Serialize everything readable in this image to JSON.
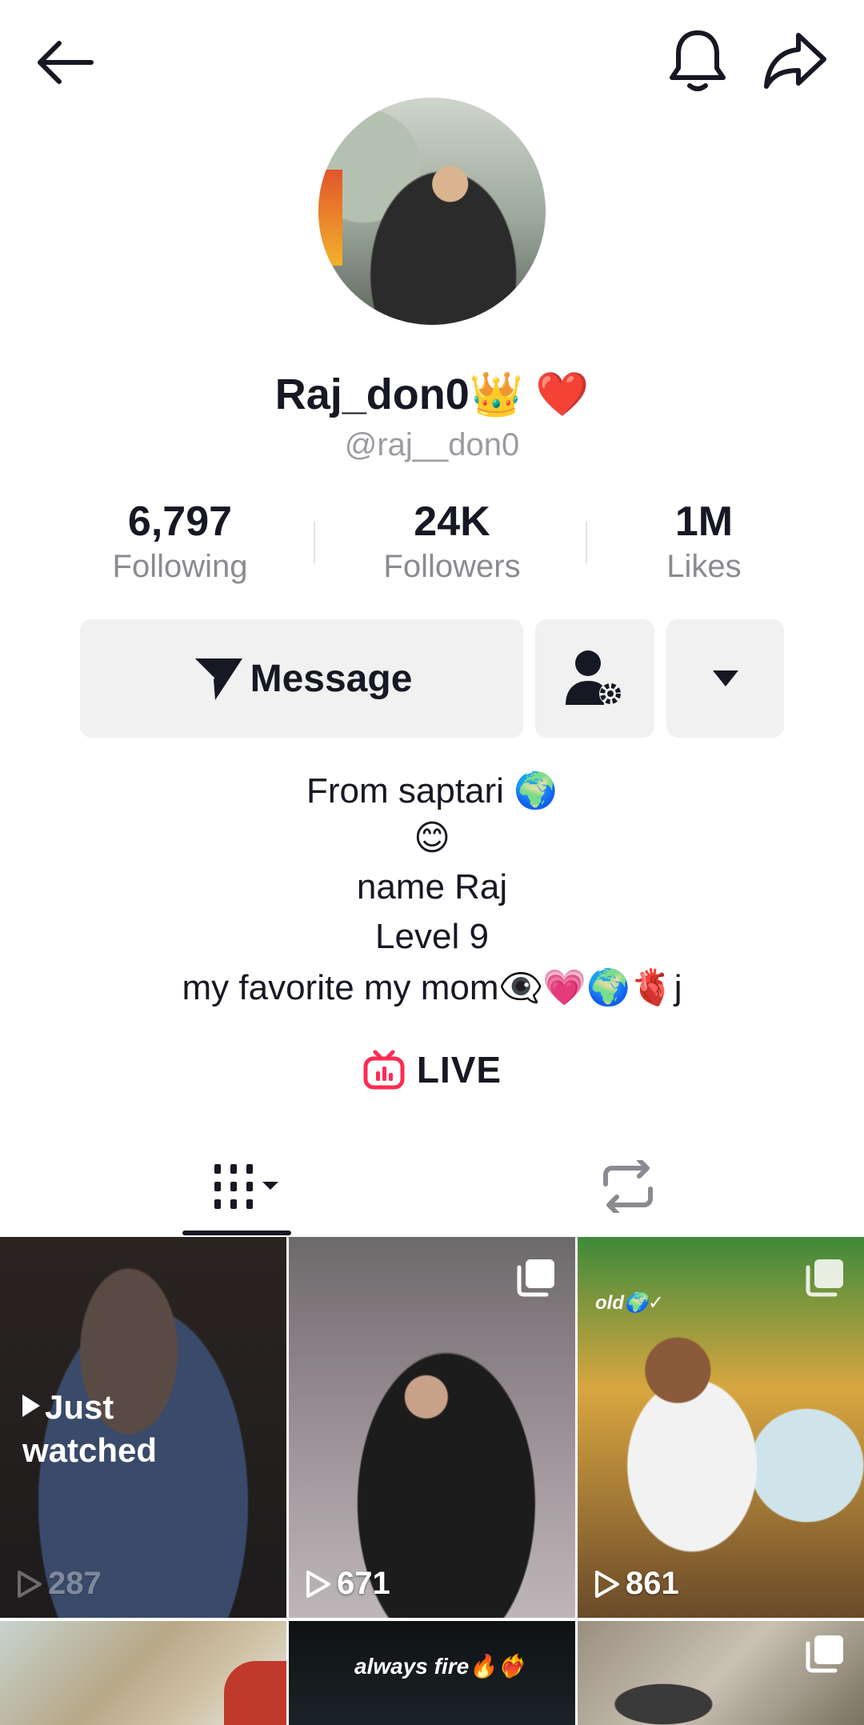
{
  "header": {
    "back_icon": "arrow-left-icon",
    "bell_icon": "bell-icon",
    "share_icon": "share-arrow-icon"
  },
  "profile": {
    "display_name": "Raj_don0👑 ❤️",
    "handle": "@raj__don0"
  },
  "stats": [
    {
      "value": "6,797",
      "label": "Following"
    },
    {
      "value": "24K",
      "label": "Followers"
    },
    {
      "value": "1M",
      "label": "Likes"
    }
  ],
  "actions": {
    "message_label": "Message",
    "message_icon": "paper-plane-icon",
    "user_settings_icon": "user-gear-icon",
    "more_icon": "triangle-down-icon"
  },
  "bio": [
    "From saptari 🌍",
    "😊",
    "name Raj",
    "Level 9",
    "my favorite  my mom👁️‍🗨️💗🌍🫀j"
  ],
  "live": {
    "label": "LIVE",
    "icon": "tv-live-icon"
  },
  "tabs": [
    {
      "icon": "grid-videos-icon"
    },
    {
      "icon": "repost-icon"
    }
  ],
  "videos": [
    {
      "views": "287",
      "badge": "Just\nwatched",
      "badge_line1": "Just",
      "badge_line2": "watched"
    },
    {
      "views": "671"
    },
    {
      "views": "861",
      "overlay_text": "old🌍✓"
    },
    {},
    {
      "overlay_text": "always fire🔥❤️‍🔥"
    },
    {}
  ],
  "colors": {
    "accent_live": "#fe2c55",
    "text_primary": "#161823",
    "text_secondary": "#8a8b91",
    "button_bg": "#f1f1f2"
  }
}
